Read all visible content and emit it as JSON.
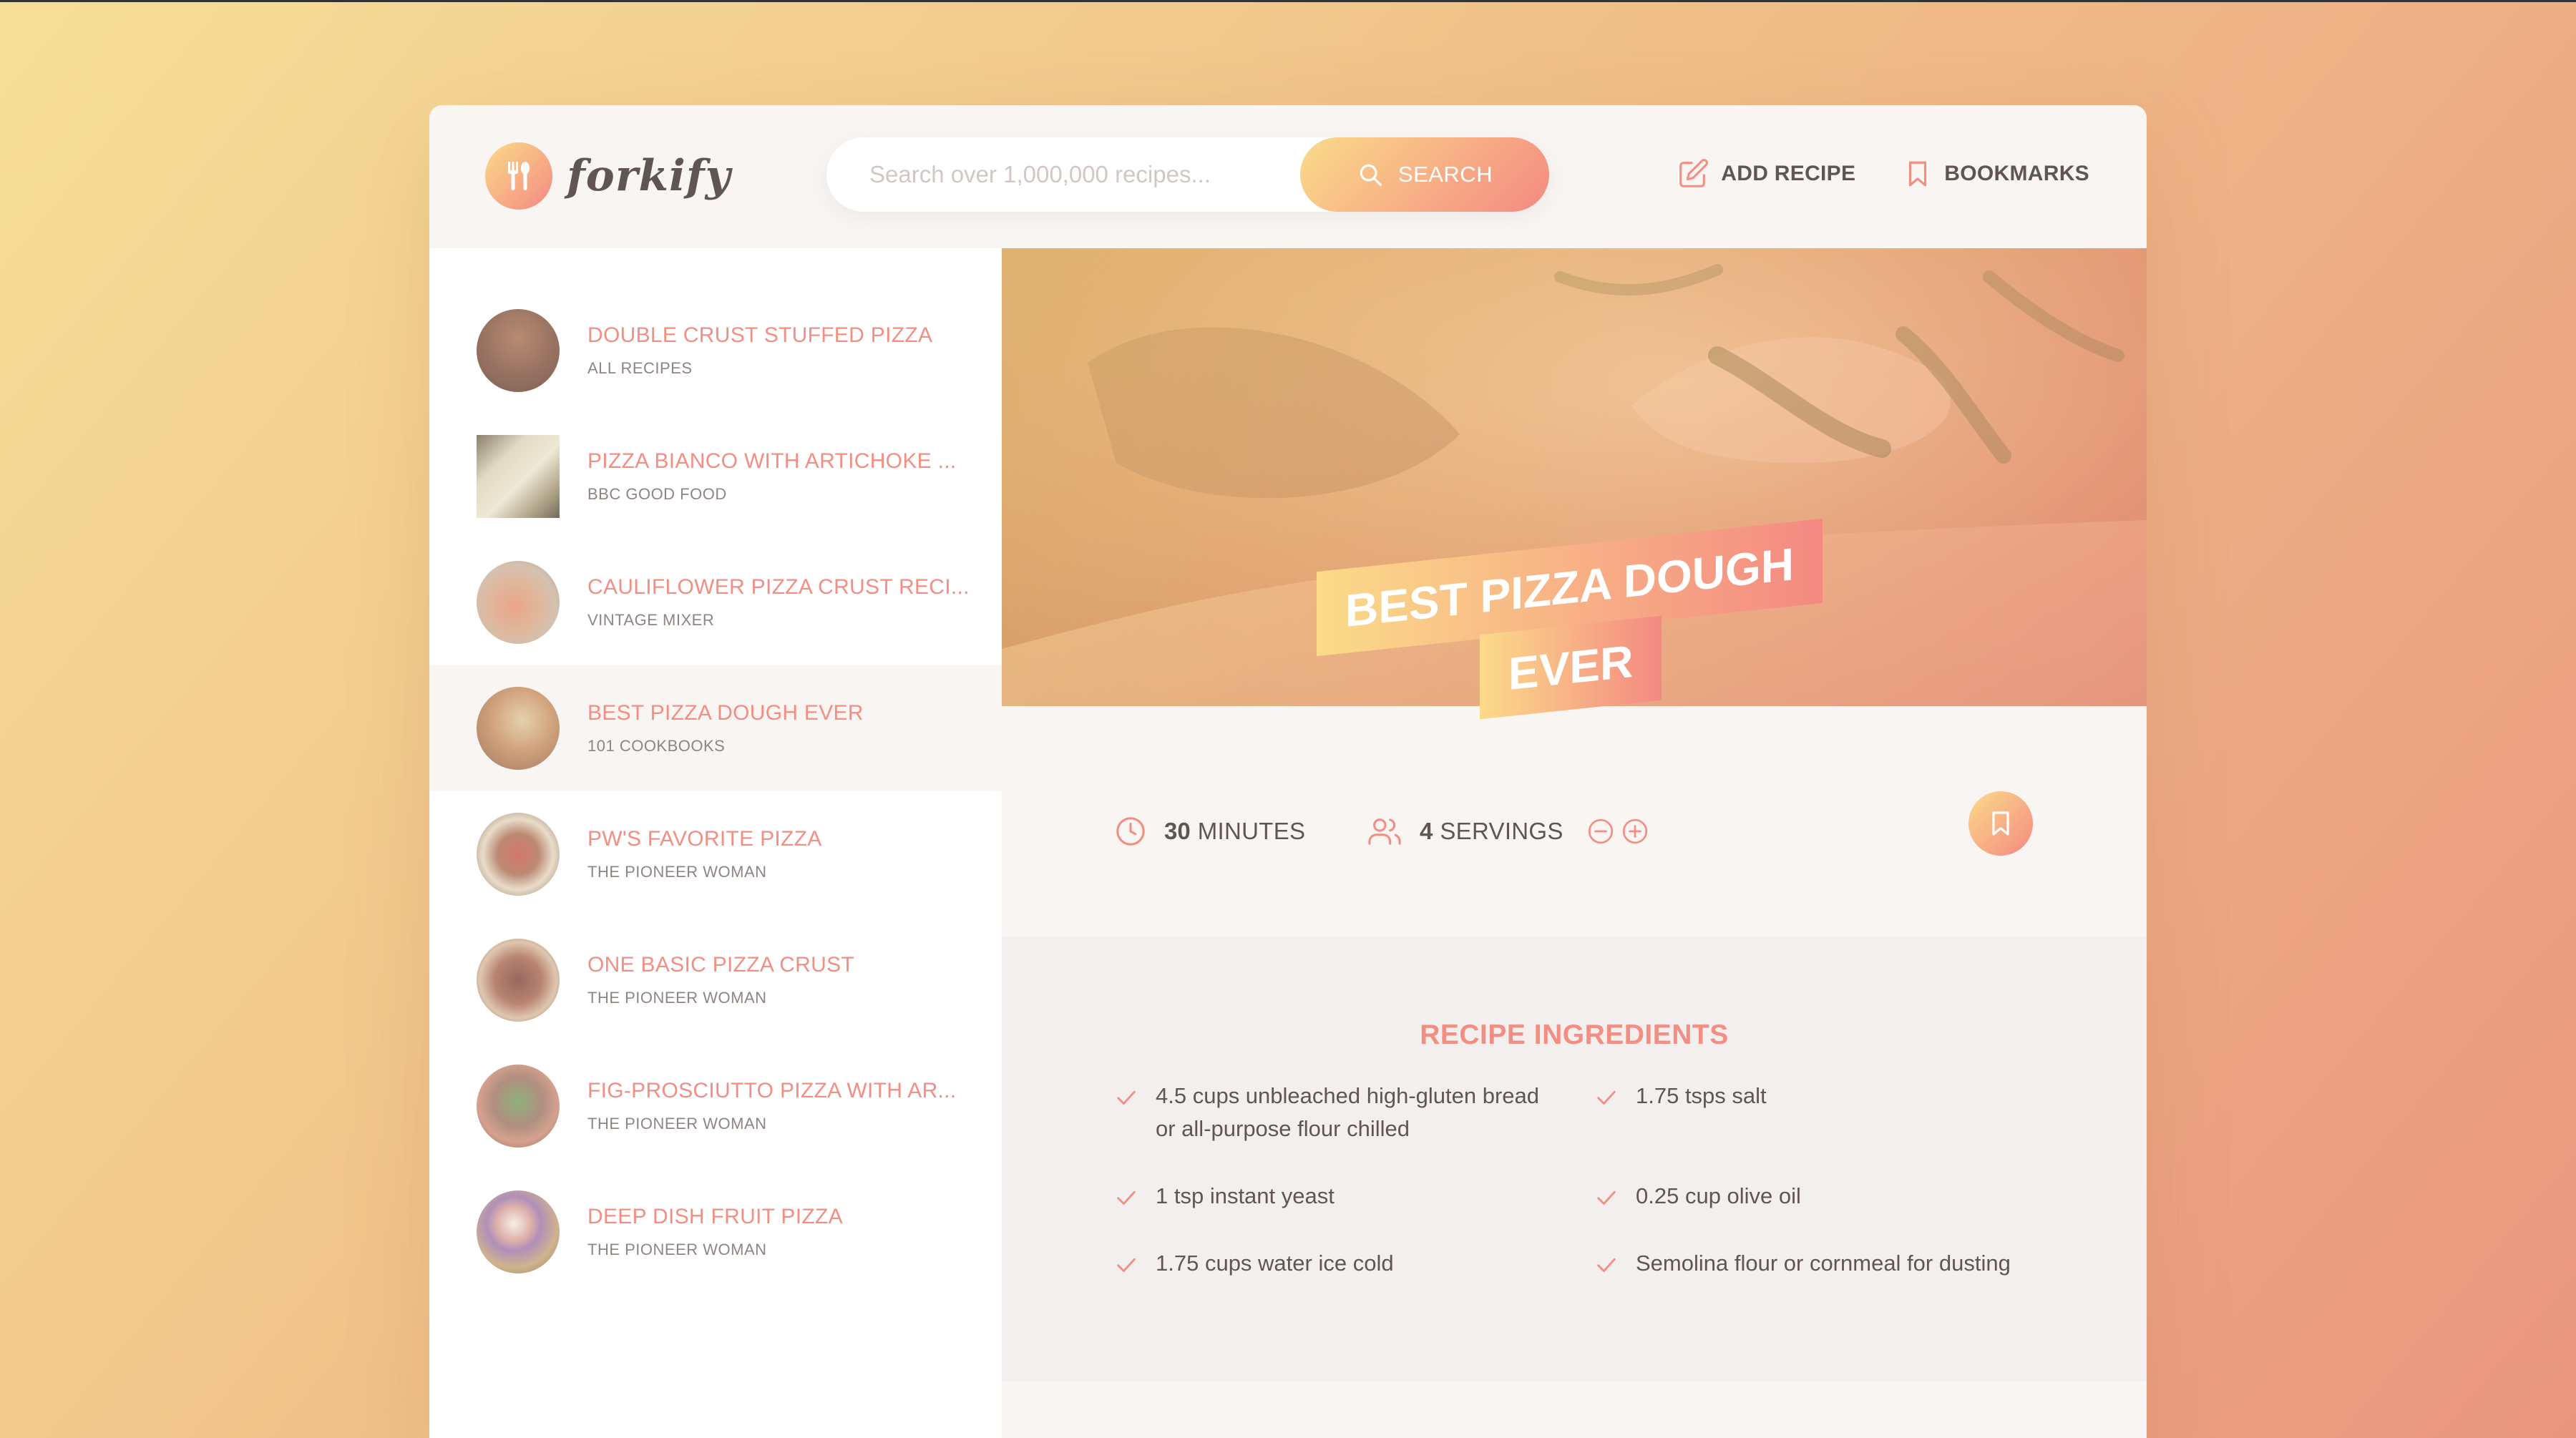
{
  "app": {
    "name": "forkify"
  },
  "search": {
    "placeholder": "Search over 1,000,000 recipes...",
    "button_label": "SEARCH"
  },
  "nav": {
    "add_recipe": "ADD RECIPE",
    "bookmarks": "BOOKMARKS"
  },
  "results": [
    {
      "title": "DOUBLE CRUST STUFFED PIZZA",
      "publisher": "ALL RECIPES"
    },
    {
      "title": "PIZZA BIANCO WITH ARTICHOKE ...",
      "publisher": "BBC GOOD FOOD"
    },
    {
      "title": "CAULIFLOWER PIZZA CRUST RECI...",
      "publisher": "VINTAGE MIXER"
    },
    {
      "title": "BEST PIZZA DOUGH EVER",
      "publisher": "101 COOKBOOKS"
    },
    {
      "title": "PW'S FAVORITE PIZZA",
      "publisher": "THE PIONEER WOMAN"
    },
    {
      "title": "ONE BASIC PIZZA CRUST",
      "publisher": "THE PIONEER WOMAN"
    },
    {
      "title": "FIG-PROSCIUTTO PIZZA WITH AR...",
      "publisher": "THE PIONEER WOMAN"
    },
    {
      "title": "DEEP DISH FRUIT PIZZA",
      "publisher": "THE PIONEER WOMAN"
    }
  ],
  "recipe": {
    "title_line1": "BEST PIZZA DOUGH",
    "title_line2": "EVER",
    "cooking_time": "30",
    "cooking_unit": "MINUTES",
    "servings": "4",
    "servings_unit": "SERVINGS",
    "ingredients_heading": "RECIPE INGREDIENTS",
    "ingredients": [
      "4.5 cups unbleached high-gluten bread or all-purpose flour chilled",
      "1.75 tsps salt",
      "1 tsp instant yeast",
      "0.25 cup olive oil",
      "1.75 cups water ice cold",
      "Semolina flour or cornmeal for dusting"
    ]
  },
  "colors": {
    "accent_light": "#fbdb89",
    "accent_dark": "#f48982",
    "text": "#615551"
  }
}
